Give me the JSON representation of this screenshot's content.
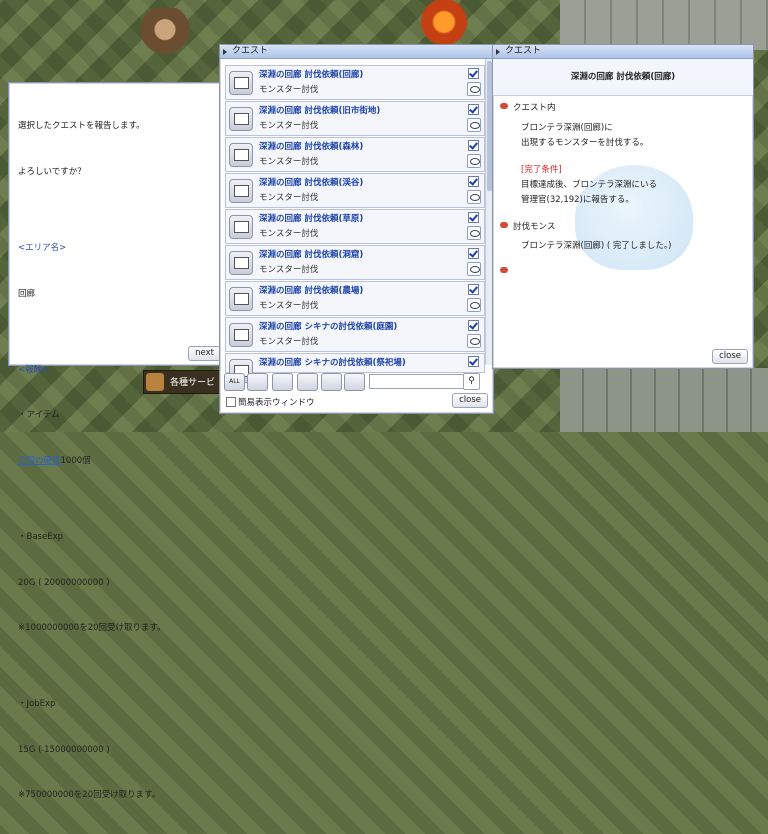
{
  "dialog": {
    "lines": [
      "選択したクエストを報告します。",
      "よろしいですか？",
      "",
      "<エリア名>",
      "回廊",
      "",
      "<報酬>",
      "・アイテム",
      "",
      "",
      "・BaseExp",
      "20G ( 20000000000 )",
      "※1000000000を20回受け取ります。",
      "",
      "・JobExp",
      "15G ( 15000000000 )",
      "※750000000を20回受け取ります。"
    ],
    "item_name": "亡国の硬貨",
    "item_count": "1000個",
    "next_label": "next"
  },
  "quest_list": {
    "title": "クエスト",
    "rows": [
      {
        "title": "深淵の回廊 討伐依頼(回廊)",
        "sub": "モンスター討伐"
      },
      {
        "title": "深淵の回廊 討伐依頼(旧市街地)",
        "sub": "モンスター討伐"
      },
      {
        "title": "深淵の回廊 討伐依頼(森林)",
        "sub": "モンスター討伐"
      },
      {
        "title": "深淵の回廊 討伐依頼(渓谷)",
        "sub": "モンスター討伐"
      },
      {
        "title": "深淵の回廊 討伐依頼(草原)",
        "sub": "モンスター討伐"
      },
      {
        "title": "深淵の回廊 討伐依頼(洞窟)",
        "sub": "モンスター討伐"
      },
      {
        "title": "深淵の回廊 討伐依頼(農場)",
        "sub": "モンスター討伐"
      },
      {
        "title": "深淵の回廊 シキナの討伐依頼(庭園)",
        "sub": "モンスター討伐"
      },
      {
        "title": "深淵の回廊 シキナの討伐依頼(祭祀場)",
        "sub": ""
      }
    ],
    "filters": [
      "ALL",
      "",
      "",
      "",
      "",
      ""
    ],
    "simple_label": "簡易表示ウィンドウ",
    "close_label": "close"
  },
  "detail": {
    "title": "クエスト",
    "quest_name": "深淵の回廊 討伐依頼(回廊)",
    "section1": "クエスト内",
    "desc": "ブロンテラ深淵(回廊)に\n出現するモンスターを討伐する。",
    "cond_label": "[完了条件]",
    "cond": "目標達成後、ブロンテラ深淵にいる\n管理官(32,192)に報告する。",
    "section2": "討伐モンス",
    "done": "ブロンテラ深淵(回廊) ( 完了しました。)",
    "close_label": "close"
  },
  "background": {
    "service_label": "各種サービ"
  }
}
